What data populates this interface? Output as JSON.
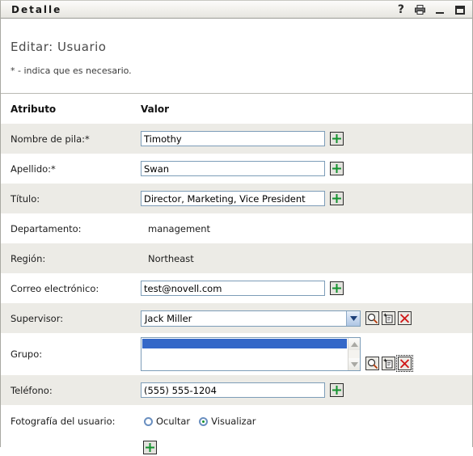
{
  "window": {
    "title": "Detalle",
    "controls": [
      {
        "name": "help-button",
        "glyph": "?"
      },
      {
        "name": "print-button",
        "glyph": "printer"
      },
      {
        "name": "minimize-button",
        "glyph": "_"
      },
      {
        "name": "maximize-button",
        "glyph": "square"
      }
    ]
  },
  "header": {
    "page_title": "Editar: Usuario",
    "required_note": "* - indica que es necesario."
  },
  "table": {
    "col_attribute": "Atributo",
    "col_value": "Valor"
  },
  "rows": {
    "first_name": {
      "label": "Nombre de pila:*",
      "value": "Timothy"
    },
    "last_name": {
      "label": "Apellido:*",
      "value": "Swan"
    },
    "title": {
      "label": "Título:",
      "value": "Director, Marketing, Vice President"
    },
    "department": {
      "label": "Departamento:",
      "value": "management"
    },
    "region": {
      "label": "Región:",
      "value": "Northeast"
    },
    "email": {
      "label": "Correo electrónico:",
      "value": "test@novell.com"
    },
    "supervisor": {
      "label": "Supervisor:",
      "value": "Jack Miller"
    },
    "group": {
      "label": "Grupo:",
      "value": ""
    },
    "phone": {
      "label": "Teléfono:",
      "value": "(555) 555-1204"
    },
    "photo": {
      "label": "Fotografía del usuario:",
      "option_hide": "Ocultar",
      "option_show": "Visualizar",
      "selected": "Visualizar"
    }
  },
  "icons": {
    "add": "plus-icon",
    "search": "magnifier-icon",
    "history": "history-clipboard-icon",
    "delete": "red-x-delete-icon",
    "dropdown": "chevron-down-icon",
    "scroll_up": "scroll-up-arrow-icon",
    "scroll_down": "scroll-down-arrow-icon"
  },
  "colors": {
    "stripe": "#ecebe6",
    "input_border": "#7d9db8",
    "selection_blue": "#3468c8",
    "plus_green": "#15922f",
    "delete_red": "#d01818"
  }
}
